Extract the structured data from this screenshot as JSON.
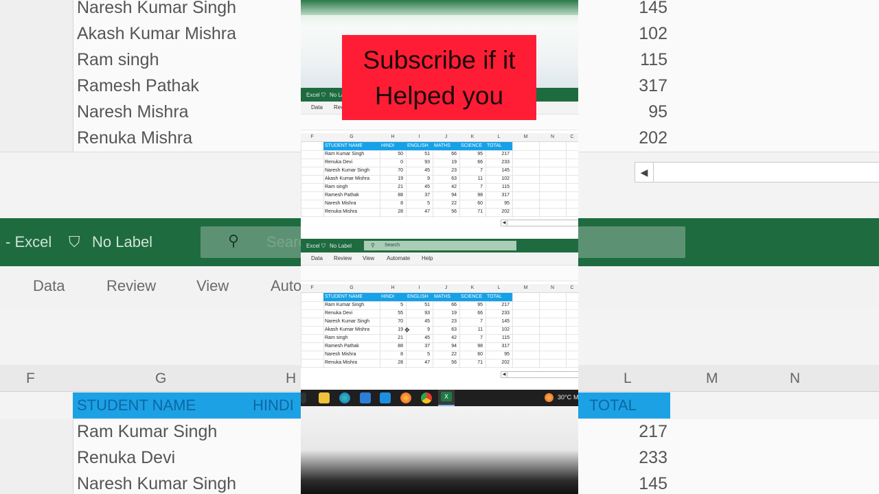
{
  "background": {
    "top_rows": [
      {
        "name": "Naresh Kumar Singh",
        "total": "145"
      },
      {
        "name": "Akash Kumar Mishra",
        "total": "102"
      },
      {
        "name": "Ram singh",
        "total": "115"
      },
      {
        "name": "Ramesh Pathak",
        "total": "317"
      },
      {
        "name": "Naresh Mishra",
        "total": "95"
      },
      {
        "name": "Renuka Mishra",
        "total": "202"
      }
    ],
    "titlebar": {
      "app": "- Excel",
      "label": "No Label",
      "search": "Search"
    },
    "menu": [
      "Data",
      "Review",
      "View",
      "Auto"
    ],
    "columns": [
      "F",
      "G",
      "H",
      "L",
      "M",
      "N"
    ],
    "header_cells": [
      "STUDENT NAME",
      "HINDI",
      "TOTAL"
    ],
    "bottom_rows": [
      {
        "name": "Ram Kumar Singh",
        "total": "217"
      },
      {
        "name": "Renuka Devi",
        "total": "233"
      },
      {
        "name": "Naresh Kumar Singh",
        "total": "145"
      }
    ]
  },
  "banner": {
    "line1": "Subscribe if it",
    "line2": "Helped you"
  },
  "window_top": {
    "app": "Excel",
    "label": "No La",
    "menu": [
      "Data",
      "Rev"
    ]
  },
  "window_bottom": {
    "app": "Excel",
    "label": "No Label",
    "search_placeholder": "Search",
    "menu": [
      "Data",
      "Review",
      "View",
      "Automate",
      "Help"
    ]
  },
  "columns": [
    "F",
    "G",
    "H",
    "I",
    "J",
    "K",
    "L",
    "M",
    "N",
    "C"
  ],
  "headers": [
    "STUDENT NAME",
    "HINDI",
    "ENGLISH",
    "MATHS",
    "SCIENCE",
    "TOTAL"
  ],
  "table_top": [
    [
      "Ram Kumar Singh",
      "50",
      "51",
      "66",
      "95",
      "217"
    ],
    [
      "Renuka Devi",
      "0",
      "93",
      "19",
      "66",
      "233"
    ],
    [
      "Naresh Kumar Singh",
      "70",
      "45",
      "23",
      "7",
      "145"
    ],
    [
      "Akash Kumar Mishra",
      "19",
      "9",
      "63",
      "11",
      "102"
    ],
    [
      "Ram singh",
      "21",
      "45",
      "42",
      "7",
      "115"
    ],
    [
      "Ramesh Pathak",
      "88",
      "37",
      "94",
      "98",
      "317"
    ],
    [
      "Naresh Mishra",
      "8",
      "5",
      "22",
      "60",
      "95"
    ],
    [
      "Renuka Mishra",
      "28",
      "47",
      "56",
      "71",
      "202"
    ]
  ],
  "table_bottom": [
    [
      "Ram Kumar Singh",
      "5",
      "51",
      "66",
      "95",
      "217"
    ],
    [
      "Renuka Devi",
      "55",
      "93",
      "19",
      "66",
      "233"
    ],
    [
      "Naresh Kumar Singh",
      "70",
      "45",
      "23",
      "7",
      "145"
    ],
    [
      "Akash Kumar Mishra",
      "19",
      "9",
      "63",
      "11",
      "102"
    ],
    [
      "Ram singh",
      "21",
      "45",
      "42",
      "7",
      "115"
    ],
    [
      "Ramesh Pathak",
      "88",
      "37",
      "94",
      "98",
      "317"
    ],
    [
      "Naresh Mishra",
      "8",
      "5",
      "22",
      "60",
      "95"
    ],
    [
      "Renuka Mishra",
      "28",
      "47",
      "56",
      "71",
      "202"
    ]
  ],
  "taskbar": {
    "icons": [
      "file-explorer-icon",
      "edge-icon",
      "store-icon",
      "mail-icon",
      "firefox-icon",
      "chrome-icon",
      "excel-icon"
    ],
    "weather": "30°C",
    "weather_trailing": "M"
  },
  "colors": {
    "excel_green": "#1e6b3f",
    "header_blue": "#15a1e8",
    "banner_red": "#ff1d35"
  }
}
